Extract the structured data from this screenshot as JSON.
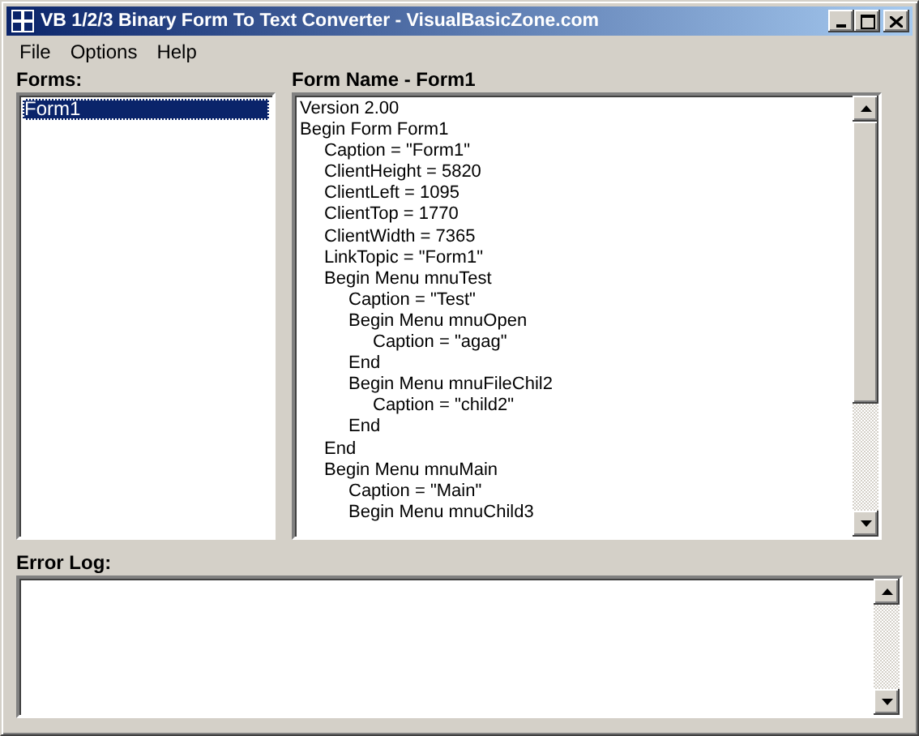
{
  "window": {
    "title": "VB 1/2/3 Binary Form To Text Converter - VisualBasicZone.com"
  },
  "menu": [
    "File",
    "Options",
    "Help"
  ],
  "forms": {
    "label": "Forms:",
    "items": [
      {
        "text": "Form1",
        "selected": true
      }
    ]
  },
  "source": {
    "label": "Form Name - Form1",
    "lines": [
      {
        "text": "Version 2.00"
      },
      {
        "text": "Begin Form Form1",
        "children": [
          {
            "text": "Caption  = \"Form1\""
          },
          {
            "text": "ClientHeight = 5820"
          },
          {
            "text": "ClientLeft = 1095"
          },
          {
            "text": "ClientTop = 1770"
          },
          {
            "text": "ClientWidth = 7365"
          },
          {
            "text": "LinkTopic  = \"Form1\""
          },
          {
            "text": "Begin Menu mnuTest",
            "children": [
              {
                "text": "Caption  = \"Test\""
              },
              {
                "text": "Begin Menu mnuOpen",
                "children": [
                  {
                    "text": "Caption  = \"agag\""
                  }
                ]
              },
              {
                "text": "End"
              },
              {
                "text": "Begin Menu mnuFileChil2",
                "children": [
                  {
                    "text": "Caption  = \"child2\""
                  }
                ]
              },
              {
                "text": "End"
              }
            ]
          },
          {
            "text": "End"
          },
          {
            "text": "Begin Menu mnuMain",
            "children": [
              {
                "text": "Caption  = \"Main\""
              },
              {
                "text": "Begin Menu mnuChild3"
              }
            ]
          }
        ]
      }
    ]
  },
  "error_log": {
    "label": "Error Log:"
  }
}
